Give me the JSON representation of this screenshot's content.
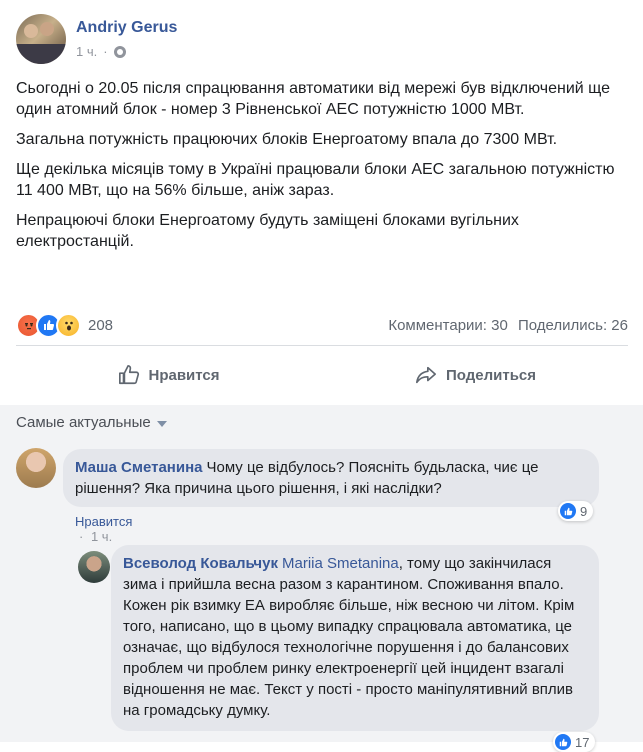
{
  "post": {
    "author": "Andriy Gerus",
    "time": "1 ч.",
    "separator": "·",
    "privacy_icon": "globe-icon",
    "paragraphs": [
      "Сьогодні о 20.05 після спрацювання автоматики від мережі був відключений ще один атомний блок - номер 3 Рівненської АЕС потужністю 1000 МВт.",
      "Загальна потужність працюючих блоків Енергоатому впала до 7300 МВт.",
      "Ще декілька місяців тому в Україні працювали блоки АЕС загальною потужністю 11 400 МВт, що на 56% більше, аніж зараз.",
      "Непрацюючі блоки Енергоатому будуть заміщені блоками вугільних електростанцій."
    ]
  },
  "reactions": {
    "icons": [
      "angry-icon",
      "like-icon",
      "wow-icon"
    ],
    "count": "208",
    "comments": "Комментарии: 30",
    "shares": "Поделились: 26"
  },
  "actions": {
    "like_label": "Нравится",
    "share_label": "Поделиться"
  },
  "comments_filter": {
    "label": "Самые актуальные"
  },
  "comments": [
    {
      "author": "Маша Сметанина",
      "text": "Чому це відбулось? Поясніть будьласка, чиє це рішення? Яка причина цього рішення, і які наслідки?",
      "like_label": "Нравится",
      "separator": "·",
      "time": "1 ч.",
      "likes": "9"
    }
  ],
  "replies": [
    {
      "author": "Всеволод Ковальчук",
      "mention": "Mariia Smetanina",
      "text": ", тому що закінчилася зима і прийшла весна разом з карантином. Споживання впало. Кожен рік взимку ЕА виробляє більше, ніж весною чи літом. Крім того, написано, що в цьому випадку спрацювала автоматика, це означає, що відбулося технологічне порушення і до балансових проблем чи проблем ринку електроенергії цей інцидент взагалі відношення не має. Текст у пості - просто маніпулятивний вплив на громадську думку.",
      "likes": "17"
    }
  ],
  "colors": {
    "link": "#385898",
    "muted": "#90949c",
    "bubble": "#e4e6eb",
    "like_blue": "#2078f4"
  }
}
